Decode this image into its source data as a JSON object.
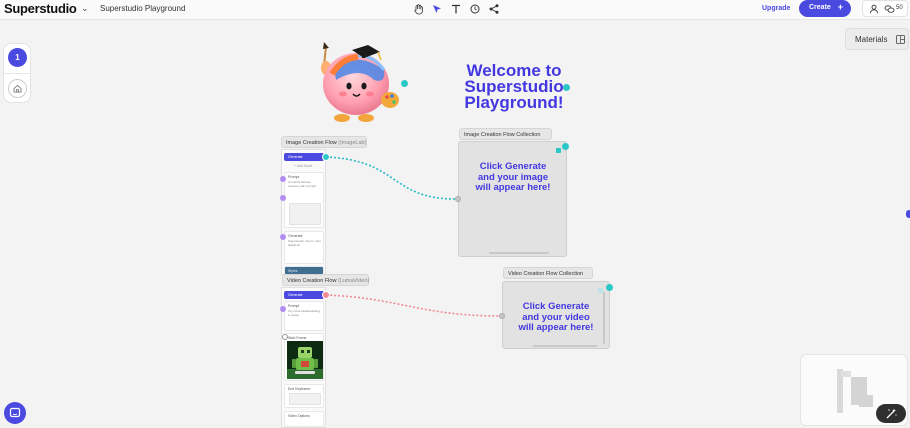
{
  "header": {
    "app_name": "Superstudio",
    "project_title": "Superstudio Playground",
    "upgrade_label": "Upgrade",
    "create_label": "Create",
    "create_plus": "+",
    "credits": "50"
  },
  "left_panel": {
    "page_number": "1"
  },
  "materials": {
    "label": "Materials"
  },
  "welcome": {
    "line1": "Welcome to",
    "line2": "Superstudio",
    "line3": "Playground!"
  },
  "image_flow": {
    "title": "Image Creation Flow",
    "subtitle": "(ImageLab)",
    "generate_label": "Generate",
    "add_label": "+ Add Node",
    "card1_label": "Prompt",
    "card1_text": "A colorful fantasy creature with a bright",
    "card2_label": "Generate",
    "card2_text": "Superstudio, Zoom, retro digital art",
    "card3_label": "Styles"
  },
  "image_collection": {
    "title": "Image Creation Flow Collection",
    "placeholder_line1": "Click Generate",
    "placeholder_line2": "and your image",
    "placeholder_line3": "will appear here!"
  },
  "video_flow": {
    "title": "Video Creation Flow",
    "subtitle": "(LumaVideo)",
    "generate_label": "Generate",
    "card1_label": "Prompt",
    "card1_text": "Toy robot skateboarding in space",
    "card2_label": "Start Frame",
    "card3_label": "End Keyframe",
    "card4_label": "Video Options"
  },
  "video_collection": {
    "title": "Video Creation Flow Collection",
    "placeholder_line1": "Click Generate",
    "placeholder_line2": "and your video",
    "placeholder_line3": "will appear here!"
  },
  "colors": {
    "accent": "#4b4ae0",
    "connector_image": "#2bb8c8",
    "connector_video": "#f08a94",
    "port_purple": "#b48cf2"
  },
  "icons": [
    "chevron-down-icon",
    "hand-icon",
    "cursor-icon",
    "text-icon",
    "timer-icon",
    "share-icon",
    "user-icon",
    "coins-icon",
    "home-icon",
    "panel-icon",
    "chat-icon",
    "magic-wand-icon"
  ]
}
